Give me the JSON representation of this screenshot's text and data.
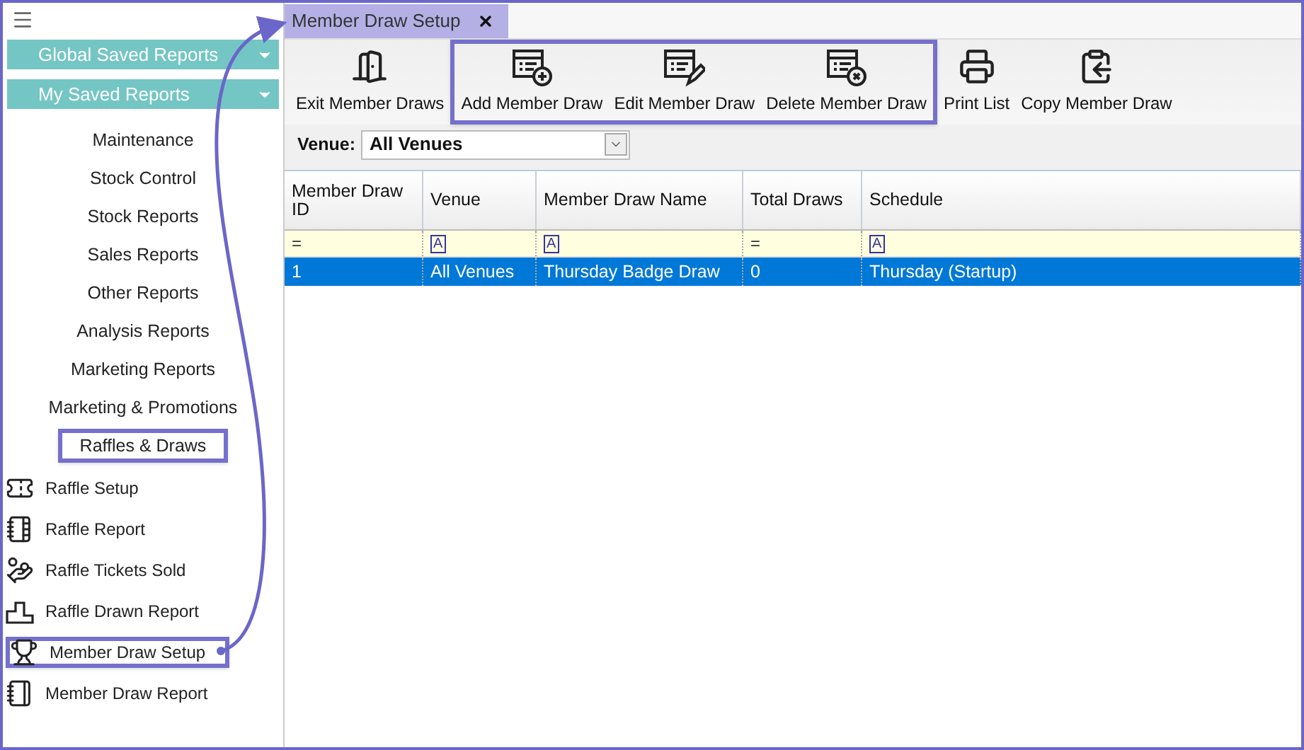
{
  "sidebar": {
    "dropdowns": [
      {
        "label": "Global Saved Reports"
      },
      {
        "label": "My Saved Reports"
      }
    ],
    "categories": [
      {
        "label": "Maintenance",
        "highlighted": false
      },
      {
        "label": "Stock Control",
        "highlighted": false
      },
      {
        "label": "Stock Reports",
        "highlighted": false
      },
      {
        "label": "Sales Reports",
        "highlighted": false
      },
      {
        "label": "Other Reports",
        "highlighted": false
      },
      {
        "label": "Analysis Reports",
        "highlighted": false
      },
      {
        "label": "Marketing Reports",
        "highlighted": false
      },
      {
        "label": "Marketing & Promotions",
        "highlighted": false
      },
      {
        "label": "Raffles & Draws",
        "highlighted": true
      }
    ],
    "items": [
      {
        "label": "Raffle Setup",
        "kind": "ticket",
        "highlighted": false
      },
      {
        "label": "Raffle Report",
        "kind": "notebook",
        "highlighted": false
      },
      {
        "label": "Raffle Tickets Sold",
        "kind": "hand",
        "highlighted": false
      },
      {
        "label": "Raffle Drawn Report",
        "kind": "podium",
        "highlighted": false
      },
      {
        "label": "Member Draw Setup",
        "kind": "trophy",
        "highlighted": true
      },
      {
        "label": "Member Draw Report",
        "kind": "report",
        "highlighted": false
      }
    ]
  },
  "tab": {
    "label": "Member Draw Setup",
    "selected": true
  },
  "toolbar": {
    "groups": [
      {
        "highlighted": false,
        "buttons": [
          {
            "label": "Exit Member Draws",
            "kind": "exit"
          }
        ]
      },
      {
        "highlighted": true,
        "buttons": [
          {
            "label": "Add Member Draw",
            "kind": "add"
          },
          {
            "label": "Edit Member Draw",
            "kind": "edit"
          },
          {
            "label": "Delete Member Draw",
            "kind": "delete"
          }
        ]
      },
      {
        "highlighted": false,
        "buttons": [
          {
            "label": "Print List",
            "kind": "print"
          },
          {
            "label": "Copy Member Draw",
            "kind": "copy"
          }
        ]
      }
    ]
  },
  "venue": {
    "label": "Venue:",
    "value": "All Venues"
  },
  "table": {
    "columns": [
      {
        "label": "Member Draw ID",
        "filter": {
          "kind": "equals",
          "symbol": "="
        }
      },
      {
        "label": "Venue",
        "filter": {
          "kind": "text",
          "symbol": "A"
        }
      },
      {
        "label": "Member Draw Name",
        "filter": {
          "kind": "text",
          "symbol": "A"
        }
      },
      {
        "label": "Total Draws",
        "filter": {
          "kind": "equals",
          "symbol": "="
        }
      },
      {
        "label": "Schedule",
        "filter": {
          "kind": "text",
          "symbol": "A"
        }
      }
    ],
    "rows": [
      {
        "selected": true,
        "cells": [
          "1",
          "All Venues",
          "Thursday Badge Draw",
          "0",
          "Thursday (Startup)"
        ]
      }
    ]
  }
}
